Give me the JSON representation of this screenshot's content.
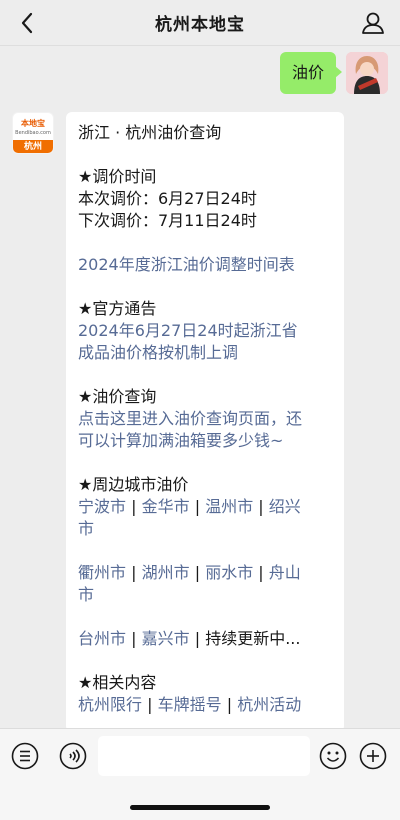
{
  "header": {
    "title": "杭州本地宝",
    "back_icon": "chevron-left-icon",
    "profile_icon": "person-icon"
  },
  "messages": {
    "user": {
      "text": "油价"
    },
    "bot": {
      "logo": {
        "brand": "本地宝",
        "domain": "Bendibao.com",
        "city": "杭州"
      },
      "card": {
        "heading": "浙江 · 杭州油价查询",
        "adjust": {
          "title": "★调价时间",
          "this_time": "本次调价：6月27日24时",
          "next_time": "下次调价：7月11日24时"
        },
        "schedule_link": "2024年度浙江油价调整时间表",
        "notice": {
          "title": "★官方通告",
          "link_line1": "2024年6月27日24时起浙江省",
          "link_line2": "成品油价格按机制上调"
        },
        "query": {
          "title": "★油价查询",
          "link_line1": "点击这里进入油价查询页面，还",
          "link_line2": "可以计算加满油箱要多少钱~"
        },
        "cities": {
          "title": "★周边城市油价",
          "row1": [
            "宁波市",
            "金华市",
            "温州市",
            "绍兴"
          ],
          "row1_wrap": "市",
          "row2": [
            "衢州市",
            "湖州市",
            "丽水市",
            "舟山"
          ],
          "row2_wrap": "市",
          "row3": [
            "台州市",
            "嘉兴市"
          ],
          "row3_tail": "持续更新中...",
          "separator": "|"
        },
        "related": {
          "title": "★相关内容",
          "items": [
            "杭州限行",
            "车牌摇号",
            "杭州活动"
          ]
        }
      }
    }
  },
  "footer": {
    "menu_icon": "list-menu-icon",
    "voice_icon": "voice-icon",
    "emoji_icon": "emoji-icon",
    "plus_icon": "plus-circle-icon"
  }
}
